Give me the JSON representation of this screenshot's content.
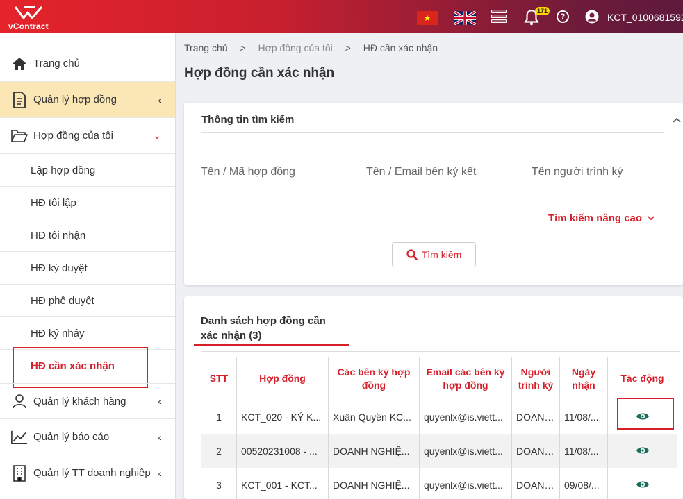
{
  "header": {
    "logo_text": "vContract",
    "notification_count": "171",
    "username": "KCT_0100681592",
    "accent": "#d71f2c"
  },
  "sidebar": {
    "items": [
      {
        "label": "Trang chủ",
        "icon": "home-icon"
      },
      {
        "label": "Quản lý hợp đồng",
        "icon": "document-icon"
      },
      {
        "label": "Hợp đồng của tôi",
        "icon": "folder-icon"
      },
      {
        "label": "Quản lý khách hàng",
        "icon": "user-icon"
      },
      {
        "label": "Quản lý báo cáo",
        "icon": "chart-icon"
      },
      {
        "label": "Quản lý TT doanh nghiệp",
        "icon": "building-icon"
      }
    ],
    "subitems": [
      "Lập hợp đồng",
      "HĐ tôi lập",
      "HĐ tôi nhận",
      "HĐ ký duyệt",
      "HĐ phê duyệt",
      "HĐ ký nháy",
      "HĐ cần xác nhận"
    ]
  },
  "breadcrumb": {
    "home": "Trang chủ",
    "sep": ">",
    "parent": "Hợp đồng của tôi",
    "current": "HĐ cần xác nhận"
  },
  "page_title": "Hợp đồng cần xác nhận",
  "search": {
    "title": "Thông tin tìm kiếm",
    "field1_placeholder": "Tên / Mã hợp đồng",
    "field2_placeholder": "Tên / Email bên ký kết",
    "field3_placeholder": "Tên người trình ký",
    "advanced_label": "Tìm kiếm nâng cao",
    "button_label": "Tìm kiếm"
  },
  "list": {
    "title": "Danh sách hợp đồng cần xác nhận (3)",
    "columns": [
      "STT",
      "Hợp đồng",
      "Các bên ký hợp đồng",
      "Email các bên ký hợp đồng",
      "Người trình ký",
      "Ngày nhận",
      "Tác động"
    ],
    "rows": [
      {
        "stt": "1",
        "contract": "KCT_020 - KÝ K...",
        "parties": "Xuân Quyền KC...",
        "email": "quyenlx@is.viett...",
        "submitter": "DOANH...",
        "date": "11/08/..."
      },
      {
        "stt": "2",
        "contract": "00520231008 - ...",
        "parties": "DOANH NGHIỆ...",
        "email": "quyenlx@is.viett...",
        "submitter": "DOANH...",
        "date": "11/08/..."
      },
      {
        "stt": "3",
        "contract": "KCT_001 - KCT...",
        "parties": "DOANH NGHIỆ...",
        "email": "quyenlx@is.viett...",
        "submitter": "DOANH...",
        "date": "09/08/..."
      }
    ]
  }
}
